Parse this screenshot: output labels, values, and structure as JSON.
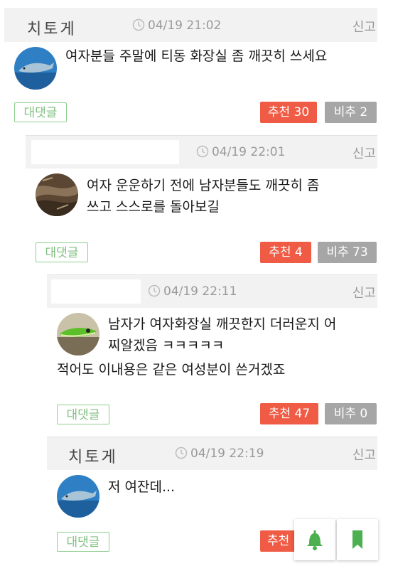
{
  "comments": [
    {
      "nickname": "치토게",
      "time": "04/19 21:02",
      "report": "신고",
      "lines": [
        "여자분들 주말에 티동 화장실 좀 깨끗히 쓰세요"
      ],
      "reply": "대댓글",
      "up": "추천 30",
      "down": "비추 2"
    },
    {
      "nickname": "",
      "time": "04/19 22:01",
      "report": "신고",
      "lines": [
        "여자 운운하기 전에 남자분들도 깨끗히 좀",
        "쓰고 스스로를 돌아보길"
      ],
      "reply": "대댓글",
      "up": "추천 4",
      "down": "비추 73"
    },
    {
      "nickname": "",
      "time": "04/19 22:11",
      "report": "신고",
      "lines": [
        "남자가 여자화장실 깨끗한지 더러운지 어",
        "찌알겠음 ㅋㅋㅋㅋㅋ",
        "적어도 이내용은 같은 여성분이 쓴거겠죠"
      ],
      "reply": "대댓글",
      "up": "추천 47",
      "down": "비추 0"
    },
    {
      "nickname": "치토게",
      "time": "04/19 22:19",
      "report": "신고",
      "lines": [
        "저 여잔데..."
      ],
      "reply": "대댓글",
      "up": "추천"
    }
  ],
  "colors": {
    "up": "#ef5b45",
    "down": "#a6a6a6",
    "reply_border": "#8fcf8f",
    "fab_icon": "#4caf50"
  },
  "icons": {
    "time": "clock-icon",
    "fab1": "bell-icon",
    "fab2": "bookmark-icon"
  }
}
